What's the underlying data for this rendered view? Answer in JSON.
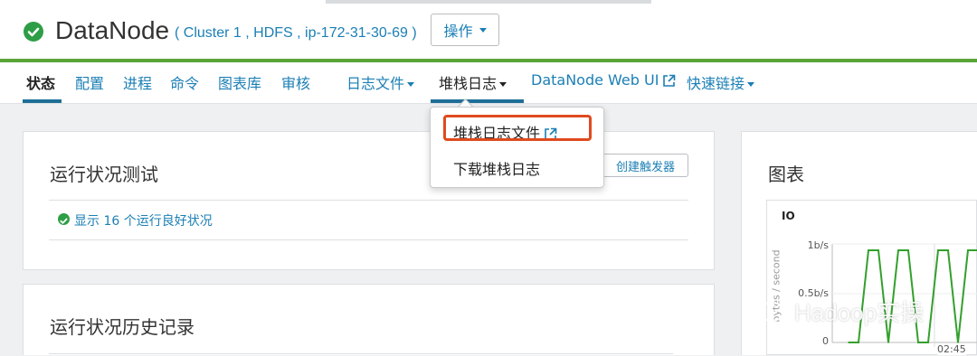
{
  "header": {
    "title": "DataNode",
    "subtitle": "( Cluster 1 , HDFS , ip-172-31-30-69 )",
    "actions_label": "操作"
  },
  "nav": {
    "items": [
      {
        "label": "状态"
      },
      {
        "label": "配置"
      },
      {
        "label": "进程"
      },
      {
        "label": "命令"
      },
      {
        "label": "图表库"
      },
      {
        "label": "审核"
      },
      {
        "label": "日志文件"
      },
      {
        "label": "堆栈日志"
      },
      {
        "label": "DataNode Web UI"
      },
      {
        "label": "快速链接"
      }
    ]
  },
  "dropdown": {
    "items": [
      {
        "label": "堆栈日志文件"
      },
      {
        "label": "下载堆栈日志"
      }
    ]
  },
  "health": {
    "title": "运行状况测试",
    "create_trigger_label": "创建触发器",
    "summary": "显示 16 个运行良好状况"
  },
  "history": {
    "title": "运行状况历史记录"
  },
  "charts": {
    "title": "图表",
    "io_chart": {
      "title": "IO",
      "ylabel": "bytes / second",
      "y_ticks": [
        "1b/s",
        "0.5b/s",
        "0"
      ],
      "x_tick": "02:45"
    }
  },
  "chart_data": {
    "type": "line",
    "title": "IO",
    "ylabel": "bytes / second",
    "y_tick_labels": [
      "1b/s",
      "0.5b/s",
      "0"
    ],
    "ylim": [
      0,
      1
    ],
    "x_tick_labels": [
      "02:45"
    ],
    "series": [
      {
        "color": "#33a02c",
        "values": [
          0,
          0,
          1,
          1,
          0,
          1,
          1,
          0,
          0,
          1,
          1,
          0,
          1,
          1
        ]
      }
    ]
  },
  "watermark": "Hadoop实操",
  "colors": {
    "accent_green": "#5aa437",
    "link_blue": "#1b7fb5",
    "highlight_red": "#e04a1e",
    "status_green": "#2e9e46"
  }
}
